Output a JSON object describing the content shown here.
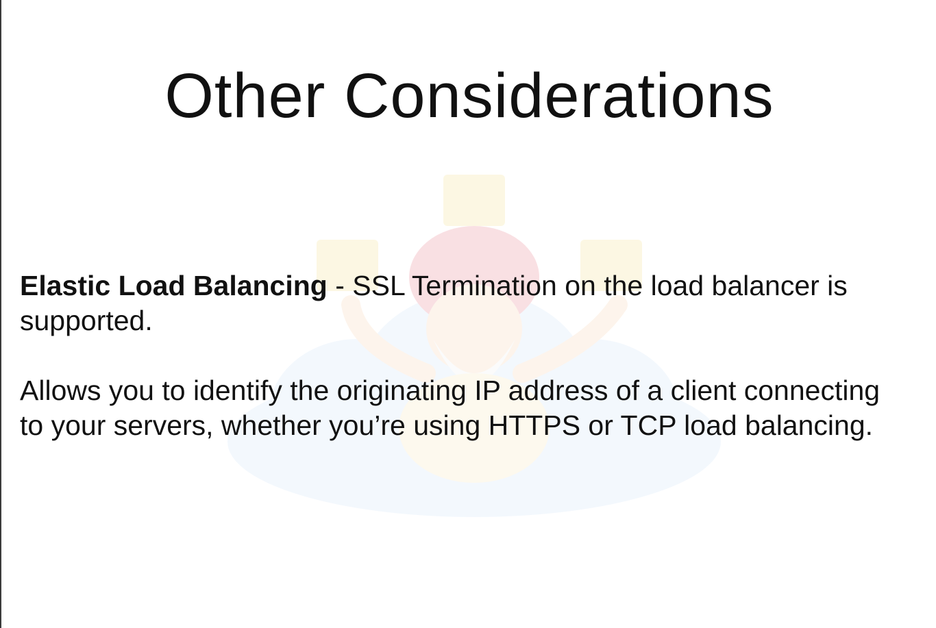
{
  "slide": {
    "title": "Other Considerations",
    "paragraph1": {
      "bold_lead": "Elastic Load Balancing",
      "separator": " - ",
      "text": "SSL Termination on the load balancer is supported."
    },
    "paragraph2": {
      "text": "Allows you to identify the originating IP address of a client connecting to your servers, whether you’re using HTTPS or TCP load balancing."
    },
    "watermark_icon": "cloud-guru-mascot-watermark"
  }
}
